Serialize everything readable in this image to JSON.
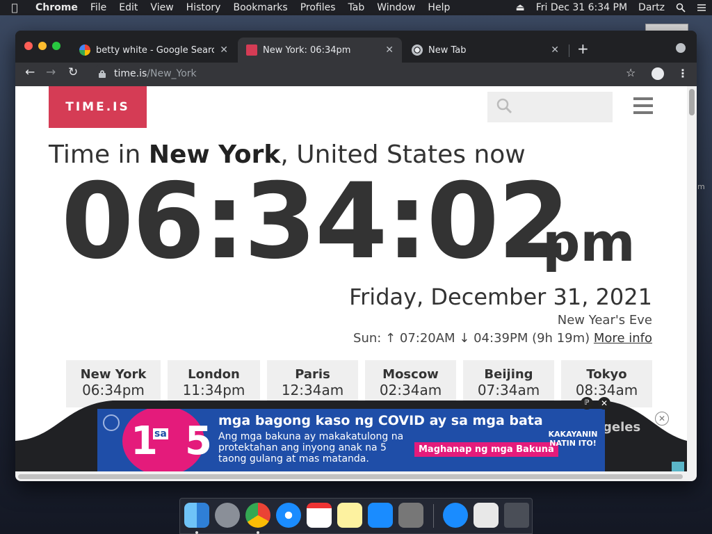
{
  "menubar": {
    "app_name": "Chrome",
    "items": [
      "File",
      "Edit",
      "View",
      "History",
      "Bookmarks",
      "Profiles",
      "Tab",
      "Window",
      "Help"
    ],
    "datetime": "Fri Dec 31  6:34 PM",
    "user": "Dartz"
  },
  "tabs": [
    {
      "title": "betty white - Google Search",
      "icon": "google-g-icon",
      "active": false
    },
    {
      "title": "New York: 06:34pm",
      "icon": "time-is-favicon-icon",
      "active": true
    },
    {
      "title": "New Tab",
      "icon": "chrome-icon",
      "active": false
    }
  ],
  "toolbar": {
    "url_host": "time.is",
    "url_path": "/New_York"
  },
  "page": {
    "logo": "TIME.IS",
    "headline_prefix": "Time in ",
    "headline_city": "New York",
    "headline_suffix": ", United States now",
    "clock": "06:34:02",
    "ampm": "pm",
    "date": "Friday, December 31, 2021",
    "holiday": "New Year's Eve",
    "sun_text": "Sun: ↑ 07:20AM ↓ 04:39PM (9h 19m)",
    "more_info": "More info",
    "cities": [
      {
        "name": "New York",
        "time": "06:34pm"
      },
      {
        "name": "London",
        "time": "11:34pm"
      },
      {
        "name": "Paris",
        "time": "12:34am"
      },
      {
        "name": "Moscow",
        "time": "02:34am"
      },
      {
        "name": "Beijing",
        "time": "07:34am"
      },
      {
        "name": "Tokyo",
        "time": "08:34am"
      }
    ],
    "hidden_city_fragment": "geles"
  },
  "ad": {
    "number_left": "1",
    "number_sa": "sa",
    "number_right": "5",
    "title": "mga bagong kaso ng COVID ay sa mga bata",
    "body": "Ang mga bakuna ay makakatulong na protektahan ang inyong anak na 5 taong gulang at mas matanda.",
    "cta": "Maghanap ng mga Bakuna",
    "brand": "KAKAYANIN NATIN ITO!"
  },
  "colors": {
    "logo_bg": "#d53c55",
    "ad_blue": "#1f4ea8",
    "ad_pink": "#e41b7b"
  }
}
